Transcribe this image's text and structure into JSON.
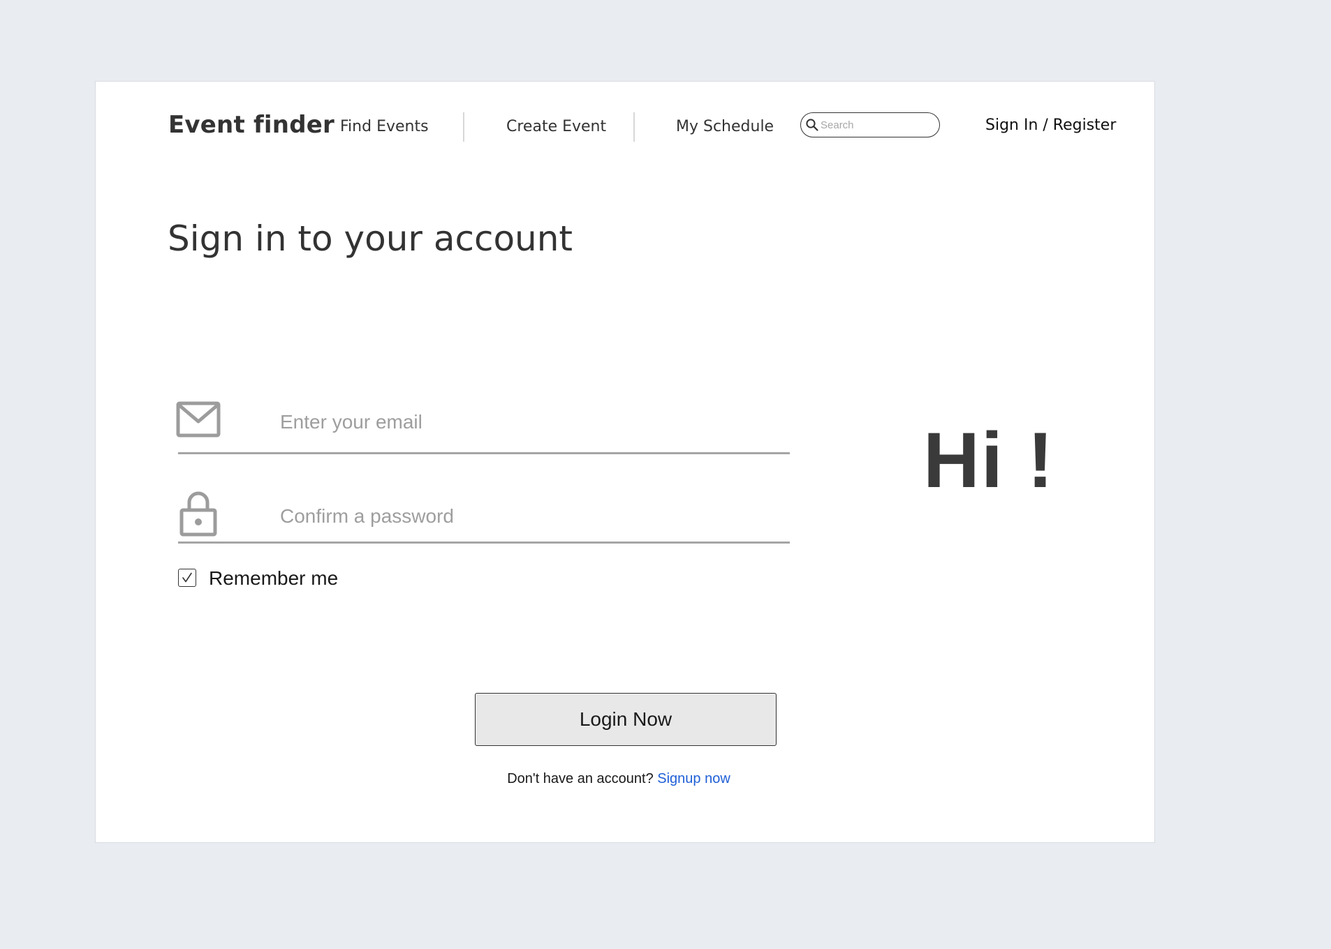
{
  "header": {
    "brand": "Event finder",
    "nav": {
      "find_events": "Find Events",
      "create_event": "Create Event",
      "my_schedule": "My Schedule"
    },
    "search": {
      "placeholder": "Search",
      "icon": "search-icon"
    },
    "signin_link": "Sign In / Register"
  },
  "main": {
    "title": "Sign in to your account",
    "email": {
      "placeholder": "Enter your email",
      "value": "",
      "icon": "mail-icon"
    },
    "password": {
      "placeholder": "Confirm a password",
      "value": "",
      "icon": "lock-icon"
    },
    "remember": {
      "label": "Remember me",
      "checked": true
    },
    "login_button": "Login Now",
    "signup_prompt": "Don't have an account?",
    "signup_link": "Signup now",
    "greeting": "Hi !"
  },
  "colors": {
    "background": "#e9edf2",
    "card": "#ffffff",
    "text": "#333333",
    "link": "#1f5fd6",
    "placeholder": "#9e9e9e",
    "button_bg": "#e8e8e8"
  }
}
